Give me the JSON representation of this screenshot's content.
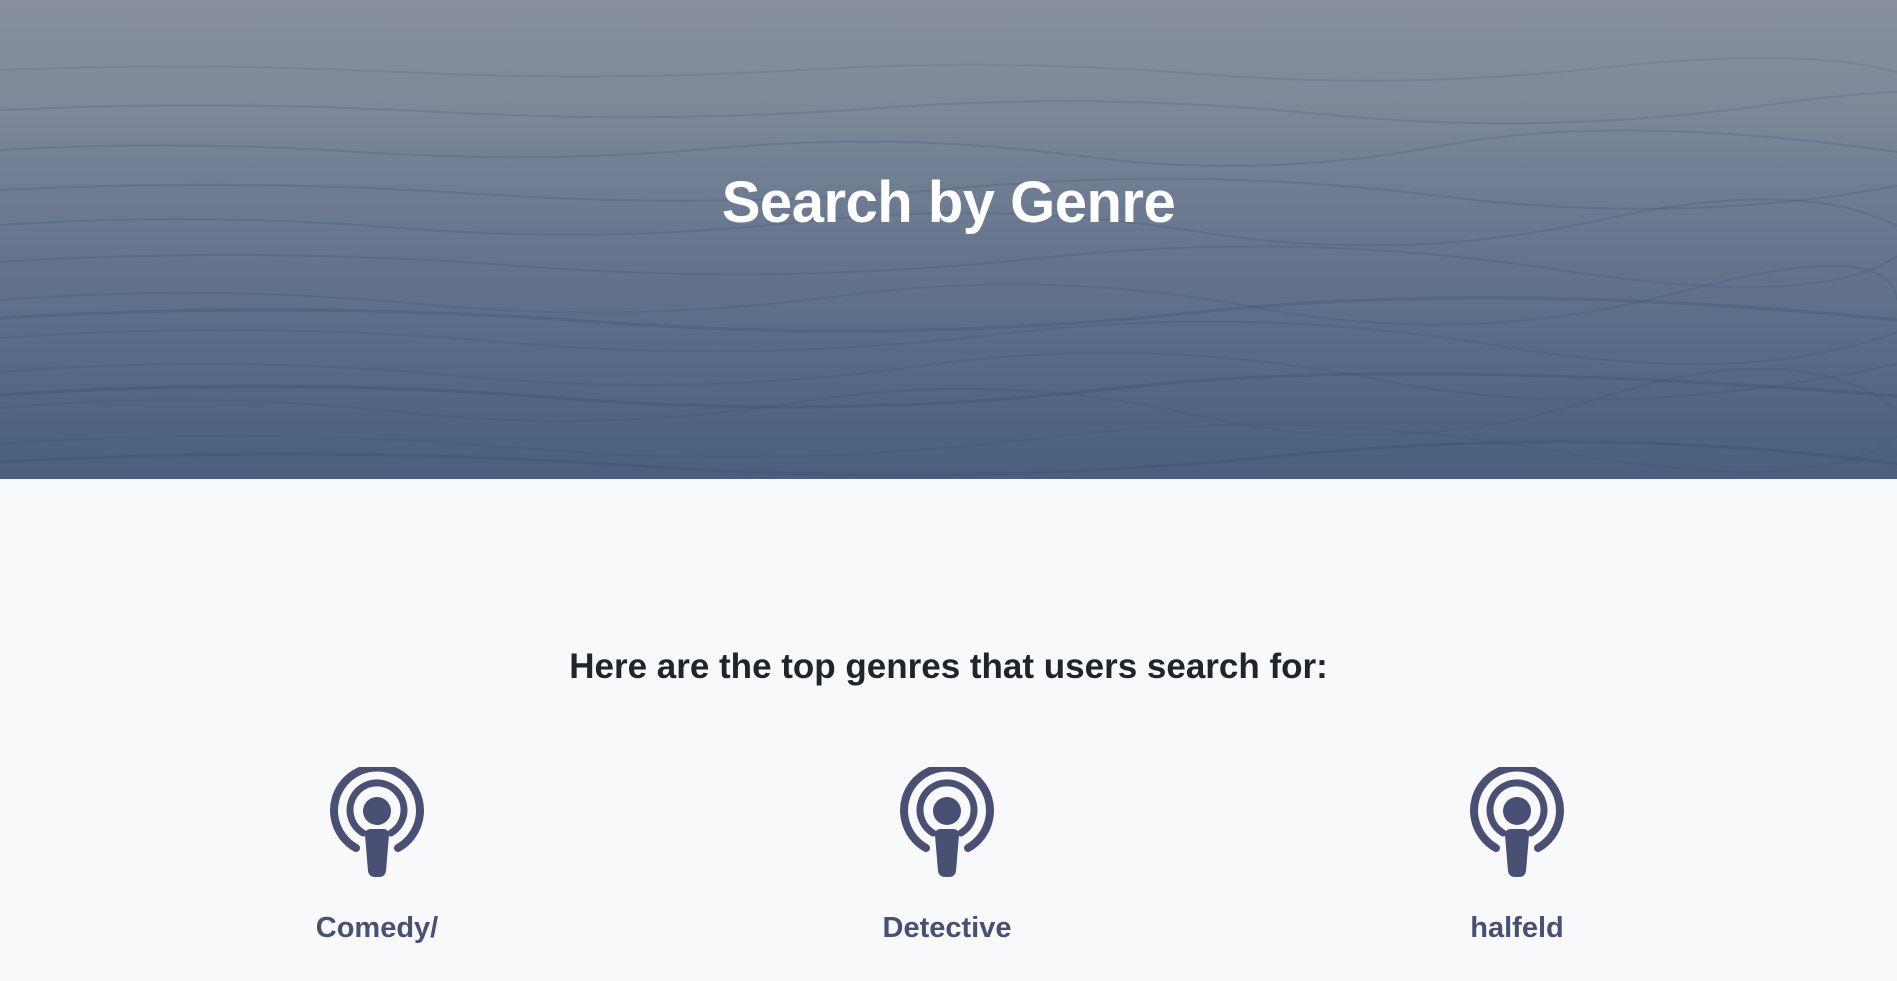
{
  "hero": {
    "title": "Search by Genre"
  },
  "main": {
    "heading": "Here are the top genres that users search for:",
    "genres": [
      {
        "label": "Comedy/",
        "icon": "podcast-icon"
      },
      {
        "label": "Detective",
        "icon": "podcast-icon"
      },
      {
        "label": "halfeld",
        "icon": "podcast-icon"
      }
    ]
  },
  "colors": {
    "hero_text": "#ffffff",
    "heading_text": "#212529",
    "icon_and_label": "#495073",
    "page_background": "#f8f9fa"
  }
}
